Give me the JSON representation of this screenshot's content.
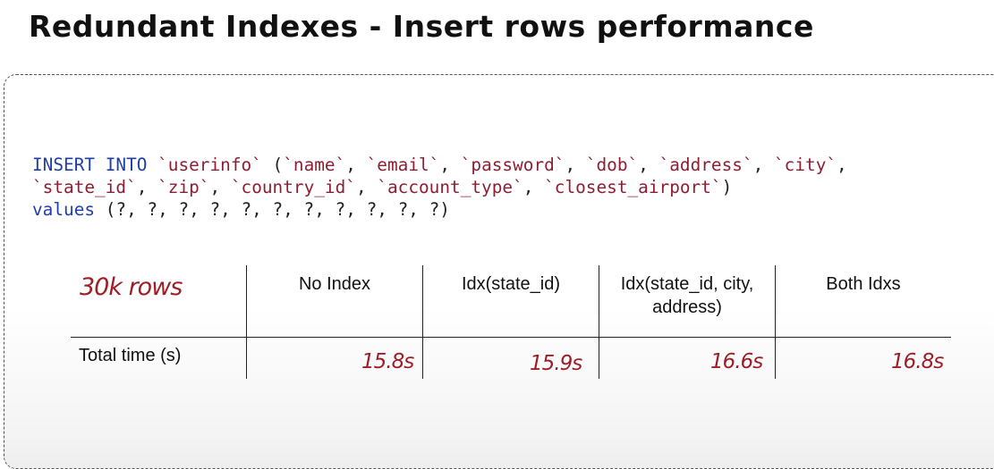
{
  "title": "Redundant Indexes - Insert rows performance",
  "sql": {
    "line1": [
      {
        "t": "kw",
        "v": "INSERT INTO"
      },
      {
        "t": "plain",
        "v": " "
      },
      {
        "t": "str",
        "v": "`userinfo`"
      },
      {
        "t": "plain",
        "v": " ("
      },
      {
        "t": "str",
        "v": "`name`"
      },
      {
        "t": "plain",
        "v": ", "
      },
      {
        "t": "str",
        "v": "`email`"
      },
      {
        "t": "plain",
        "v": ", "
      },
      {
        "t": "str",
        "v": "`password`"
      },
      {
        "t": "plain",
        "v": ", "
      },
      {
        "t": "str",
        "v": "`dob`"
      },
      {
        "t": "plain",
        "v": ", "
      },
      {
        "t": "str",
        "v": "`address`"
      },
      {
        "t": "plain",
        "v": ", "
      },
      {
        "t": "str",
        "v": "`city`"
      },
      {
        "t": "plain",
        "v": ","
      }
    ],
    "line2": [
      {
        "t": "str",
        "v": "`state_id`"
      },
      {
        "t": "plain",
        "v": ", "
      },
      {
        "t": "str",
        "v": "`zip`"
      },
      {
        "t": "plain",
        "v": ", "
      },
      {
        "t": "str",
        "v": "`country_id`"
      },
      {
        "t": "plain",
        "v": ", "
      },
      {
        "t": "str",
        "v": "`account_type`"
      },
      {
        "t": "plain",
        "v": ", "
      },
      {
        "t": "str",
        "v": "`closest_airport`"
      },
      {
        "t": "plain",
        "v": ")"
      }
    ],
    "line3": [
      {
        "t": "kw",
        "v": "values"
      },
      {
        "t": "plain",
        "v": " (?, ?, ?, ?, ?, ?, ?, ?, ?, ?, ?)"
      }
    ]
  },
  "table": {
    "corner_note": "30k rows",
    "headers": [
      "No Index",
      "Idx(state_id)",
      "Idx(state_id, city, address)",
      "Both Idxs"
    ],
    "row_label": "Total time (s)",
    "values": [
      "15.8s",
      "15.9s",
      "16.6s",
      "16.8s"
    ]
  }
}
